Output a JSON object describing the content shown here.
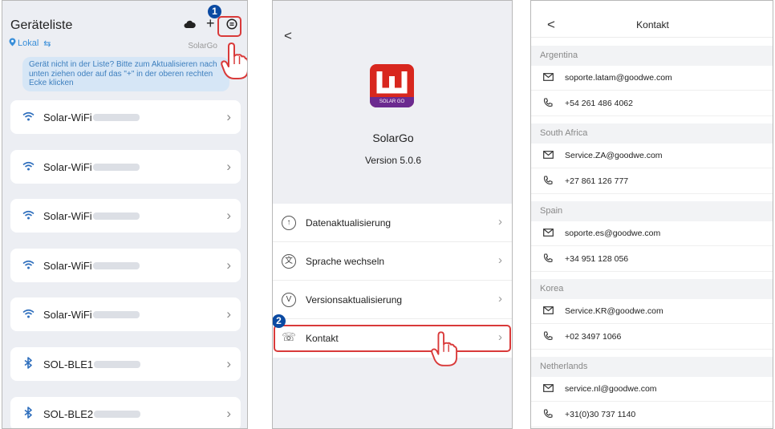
{
  "panel1": {
    "title": "Geräteliste",
    "location": "Lokal",
    "app_label": "SolarGo",
    "hint": "Gerät nicht in der Liste? Bitte zum Aktualisieren nach unten ziehen oder auf das \"+\" in der oberen rechten Ecke klicken",
    "devices": [
      {
        "name": "Solar-WiFi",
        "type": "wifi"
      },
      {
        "name": "Solar-WiFi",
        "type": "wifi"
      },
      {
        "name": "Solar-WiFi",
        "type": "wifi"
      },
      {
        "name": "Solar-WiFi",
        "type": "wifi"
      },
      {
        "name": "Solar-WiFi",
        "type": "wifi"
      },
      {
        "name": "SOL-BLE1",
        "type": "bluetooth"
      },
      {
        "name": "SOL-BLE2",
        "type": "bluetooth"
      }
    ],
    "marker": "1"
  },
  "panel2": {
    "logo_text": "SOLAR GO",
    "app_name": "SolarGo",
    "version": "Version 5.0.6",
    "menu": [
      {
        "label": "Datenaktualisierung",
        "icon": "upload-icon"
      },
      {
        "label": "Sprache wechseln",
        "icon": "language-icon"
      },
      {
        "label": "Versionsaktualisierung",
        "icon": "version-icon"
      },
      {
        "label": "Kontakt",
        "icon": "phone-icon"
      }
    ],
    "marker": "2"
  },
  "panel3": {
    "title": "Kontakt",
    "countries": [
      {
        "name": "Argentina",
        "email": "soporte.latam@goodwe.com",
        "phone": "+54 261 486 4062"
      },
      {
        "name": "South Africa",
        "email": "Service.ZA@goodwe.com",
        "phone": "+27 861 126 777"
      },
      {
        "name": "Spain",
        "email": "soporte.es@goodwe.com",
        "phone": "+34 951 128 056"
      },
      {
        "name": "Korea",
        "email": "Service.KR@goodwe.com",
        "phone": "+02 3497 1066"
      },
      {
        "name": "Netherlands",
        "email": "service.nl@goodwe.com",
        "phone": "+31(0)30 737 1140"
      }
    ]
  },
  "colors": {
    "accent_blue": "#2f6fbd",
    "highlight_red": "#d93a3a",
    "marker_blue": "#0b4aa2",
    "logo_red": "#d8271e",
    "logo_purple": "#6b2a8f"
  }
}
